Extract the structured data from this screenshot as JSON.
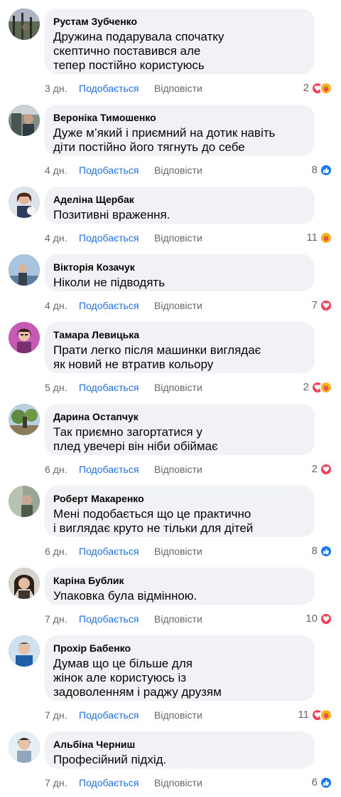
{
  "labels": {
    "like": "Подобається",
    "reply": "Відповісти"
  },
  "colors": {
    "bubble": "#f0f2f5",
    "link": "#216fdb",
    "meta": "#65676b",
    "like_reaction": "#1877f2",
    "love_reaction": "#f33e58",
    "care_reaction": "#f7b125"
  },
  "comments": [
    {
      "author": "Рустам Зубченко",
      "text": "Дружина подарувала спочатку\nскептично поставився але\nтепер постійно користуюсь",
      "time": "3 дн.",
      "reaction_count": "2",
      "reactions": [
        "love-icon",
        "care-icon"
      ]
    },
    {
      "author": "Вероніка Тимошенко",
      "text": "Дуже м’який і приємний на дотик навіть\nдіти постійно його тягнуть до себе",
      "time": "4 дн.",
      "reaction_count": "8",
      "reactions": [
        "like-icon"
      ]
    },
    {
      "author": "Аделіна Щербак",
      "text": "Позитивні враження.",
      "time": "4 дн.",
      "reaction_count": "11",
      "reactions": [
        "care-icon"
      ]
    },
    {
      "author": "Вікторія Козачук",
      "text": "Ніколи не підводять",
      "time": "4 дн.",
      "reaction_count": "7",
      "reactions": [
        "love-icon"
      ]
    },
    {
      "author": "Тамара Левицька",
      "text": "Прати легко після машинки виглядає\nяк новий не втратив кольору",
      "time": "5 дн.",
      "reaction_count": "2",
      "reactions": [
        "love-icon",
        "care-icon"
      ]
    },
    {
      "author": "Дарина Остапчук",
      "text": "Так приємно загортатися у\nплед увечері він ніби обіймає",
      "time": "6 дн.",
      "reaction_count": "2",
      "reactions": [
        "love-icon"
      ]
    },
    {
      "author": "Роберт Макаренко",
      "text": "Мені подобається що це практично\nі виглядає круто не тільки для дітей",
      "time": "6 дн.",
      "reaction_count": "8",
      "reactions": [
        "like-icon"
      ]
    },
    {
      "author": "Каріна Бублик",
      "text": "Упаковка була відмінною.",
      "time": "7 дн.",
      "reaction_count": "10",
      "reactions": [
        "love-icon"
      ]
    },
    {
      "author": "Прохір Бабенко",
      "text": "Думав що це більше для\nжінок але користуюсь із\nзадоволенням і раджу друзям",
      "time": "7 дн.",
      "reaction_count": "11",
      "reactions": [
        "love-icon",
        "care-icon"
      ]
    },
    {
      "author": "Альбіна Черниш",
      "text": "Професійний підхід.",
      "time": "7 дн.",
      "reaction_count": "6",
      "reactions": [
        "like-icon"
      ]
    }
  ]
}
